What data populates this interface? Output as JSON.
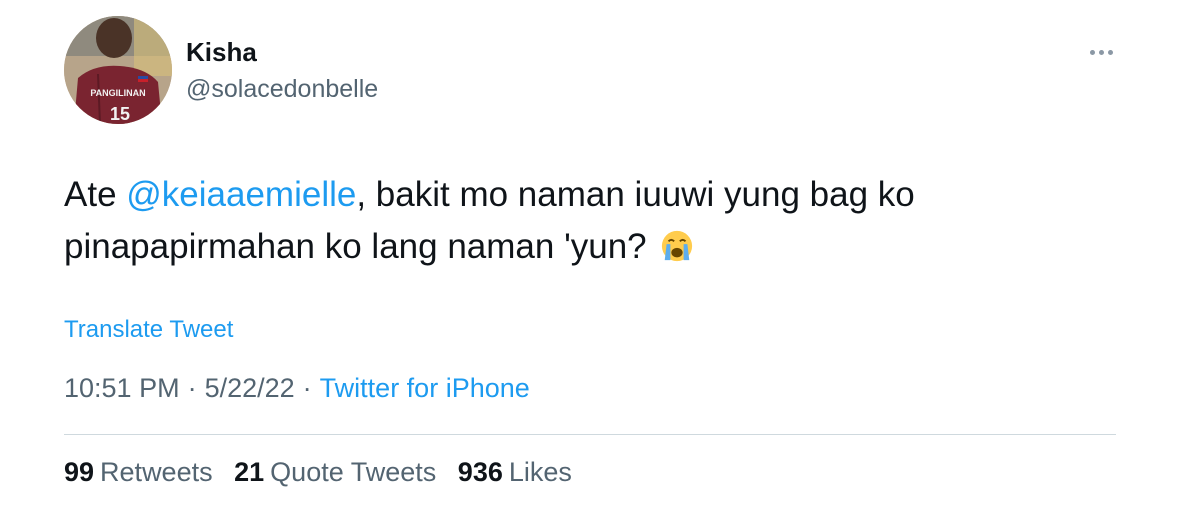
{
  "author": {
    "display_name": "Kisha",
    "handle": "@solacedonbelle",
    "avatar_icon": "avatar-photo",
    "jersey_name": "PANGILINAN",
    "jersey_number": "15"
  },
  "more_icon": "more-horizontal-icon",
  "tweet": {
    "text_before": "Ate ",
    "mention": "@keiaaemielle",
    "text_line1_rest": ", bakit mo naman iuuwi yung bag ko",
    "text_line2": "pinapapirmahan ko lang naman 'yun?",
    "emoji": "loudly-crying-face-icon"
  },
  "translate_label": "Translate Tweet",
  "meta": {
    "time": "10:51 PM",
    "separator": "·",
    "date": "5/22/22",
    "source": "Twitter for iPhone"
  },
  "stats": {
    "retweets_count": "99",
    "retweets_label": "Retweets",
    "quotes_count": "21",
    "quotes_label": "Quote Tweets",
    "likes_count": "936",
    "likes_label": "Likes"
  },
  "colors": {
    "accent": "#1d9bf0",
    "secondary_text": "#536471",
    "primary_text": "#0f1419",
    "divider": "#cfd9de"
  }
}
